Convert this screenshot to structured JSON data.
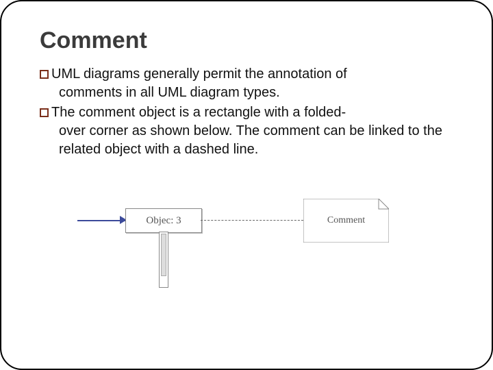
{
  "title": "Comment",
  "bullets": [
    {
      "first_line": "UML diagrams generally permit the annotation of",
      "rest": "comments in all UML diagram types."
    },
    {
      "first_line": "The comment object is a rectangle with a folded-",
      "rest": "over corner as shown below. The comment can be linked to the related object with a dashed line."
    }
  ],
  "diagram": {
    "object_label": "Objec: 3",
    "comment_label": "Comment"
  }
}
